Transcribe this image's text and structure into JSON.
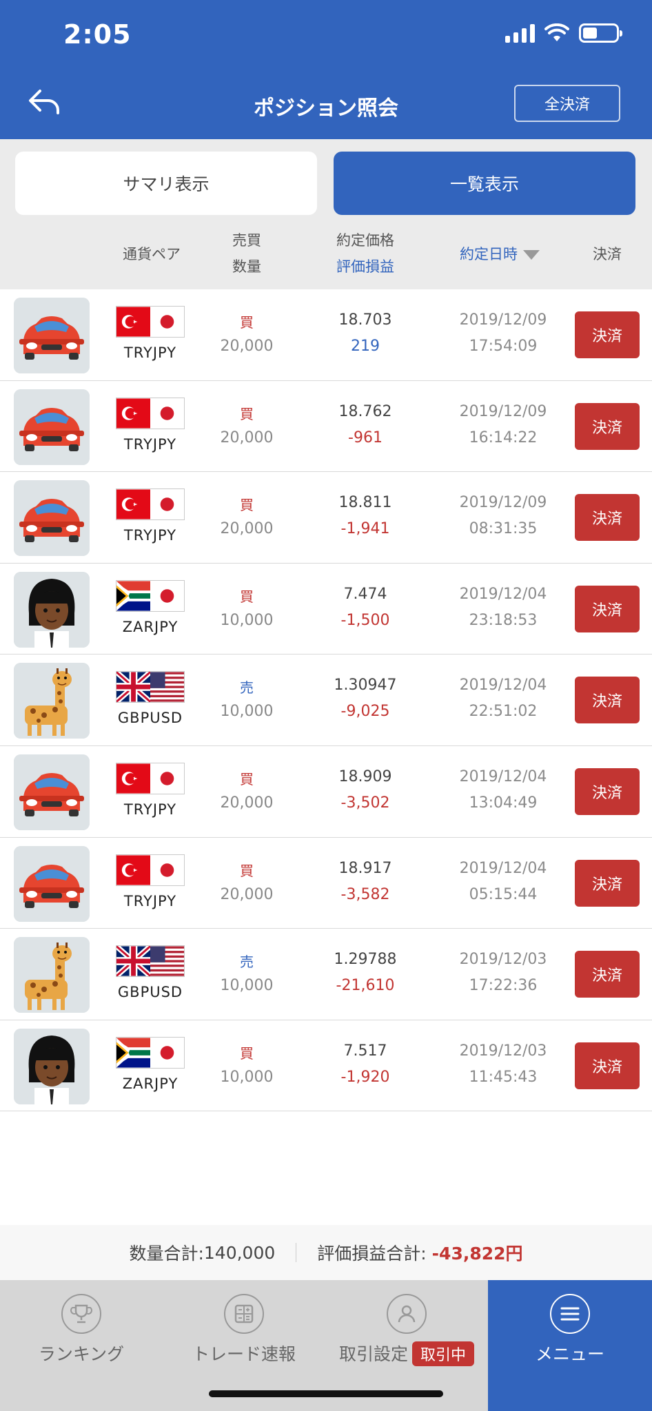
{
  "status_bar": {
    "time": "2:05"
  },
  "header": {
    "title": "ポジション照会",
    "close_all_label": "全決済"
  },
  "tabs": {
    "summary": "サマリ表示",
    "list": "一覧表示"
  },
  "columns": {
    "pair": "通貨ペア",
    "side": "売買",
    "quantity": "数量",
    "price": "約定価格",
    "pl": "評価損益",
    "datetime": "約定日時",
    "close": "決済"
  },
  "rows": [
    {
      "avatar": "car",
      "pair": "TRYJPY",
      "flags": [
        "tr",
        "jp"
      ],
      "side": "買",
      "side_type": "buy",
      "qty": "20,000",
      "price": "18.703",
      "pl": "219",
      "pl_type": "pos",
      "date": "2019/12/09",
      "time": "17:54:09",
      "close": "決済"
    },
    {
      "avatar": "car",
      "pair": "TRYJPY",
      "flags": [
        "tr",
        "jp"
      ],
      "side": "買",
      "side_type": "buy",
      "qty": "20,000",
      "price": "18.762",
      "pl": "-961",
      "pl_type": "neg",
      "date": "2019/12/09",
      "time": "16:14:22",
      "close": "決済"
    },
    {
      "avatar": "car",
      "pair": "TRYJPY",
      "flags": [
        "tr",
        "jp"
      ],
      "side": "買",
      "side_type": "buy",
      "qty": "20,000",
      "price": "18.811",
      "pl": "-1,941",
      "pl_type": "neg",
      "date": "2019/12/09",
      "time": "08:31:35",
      "close": "決済"
    },
    {
      "avatar": "girl",
      "pair": "ZARJPY",
      "flags": [
        "za",
        "jp"
      ],
      "side": "買",
      "side_type": "buy",
      "qty": "10,000",
      "price": "7.474",
      "pl": "-1,500",
      "pl_type": "neg",
      "date": "2019/12/04",
      "time": "23:18:53",
      "close": "決済"
    },
    {
      "avatar": "giraffe",
      "pair": "GBPUSD",
      "flags": [
        "gb",
        "us"
      ],
      "side": "売",
      "side_type": "sell",
      "qty": "10,000",
      "price": "1.30947",
      "pl": "-9,025",
      "pl_type": "neg",
      "date": "2019/12/04",
      "time": "22:51:02",
      "close": "決済"
    },
    {
      "avatar": "car",
      "pair": "TRYJPY",
      "flags": [
        "tr",
        "jp"
      ],
      "side": "買",
      "side_type": "buy",
      "qty": "20,000",
      "price": "18.909",
      "pl": "-3,502",
      "pl_type": "neg",
      "date": "2019/12/04",
      "time": "13:04:49",
      "close": "決済"
    },
    {
      "avatar": "car",
      "pair": "TRYJPY",
      "flags": [
        "tr",
        "jp"
      ],
      "side": "買",
      "side_type": "buy",
      "qty": "20,000",
      "price": "18.917",
      "pl": "-3,582",
      "pl_type": "neg",
      "date": "2019/12/04",
      "time": "05:15:44",
      "close": "決済"
    },
    {
      "avatar": "giraffe",
      "pair": "GBPUSD",
      "flags": [
        "gb",
        "us"
      ],
      "side": "売",
      "side_type": "sell",
      "qty": "10,000",
      "price": "1.29788",
      "pl": "-21,610",
      "pl_type": "neg",
      "date": "2019/12/03",
      "time": "17:22:36",
      "close": "決済"
    },
    {
      "avatar": "girl",
      "pair": "ZARJPY",
      "flags": [
        "za",
        "jp"
      ],
      "side": "買",
      "side_type": "buy",
      "qty": "10,000",
      "price": "7.517",
      "pl": "-1,920",
      "pl_type": "neg",
      "date": "2019/12/03",
      "time": "11:45:43",
      "close": "決済"
    }
  ],
  "totals": {
    "qty_label": "数量合計:",
    "qty_value": "140,000",
    "pl_label": "評価損益合計:",
    "pl_value": "-43,822円"
  },
  "bottom_nav": {
    "ranking": "ランキング",
    "trade_news": "トレード速報",
    "trade_settings": "取引設定",
    "trade_badge": "取引中",
    "menu": "メニュー"
  },
  "colors": {
    "primary": "#3264bd",
    "danger": "#c23532",
    "background": "#ebebeb"
  },
  "icons": [
    "back-arrow-icon",
    "signal-icon",
    "wifi-icon",
    "battery-icon",
    "sort-down-icon",
    "trophy-icon",
    "calculator-icon",
    "user-icon",
    "menu-icon"
  ]
}
